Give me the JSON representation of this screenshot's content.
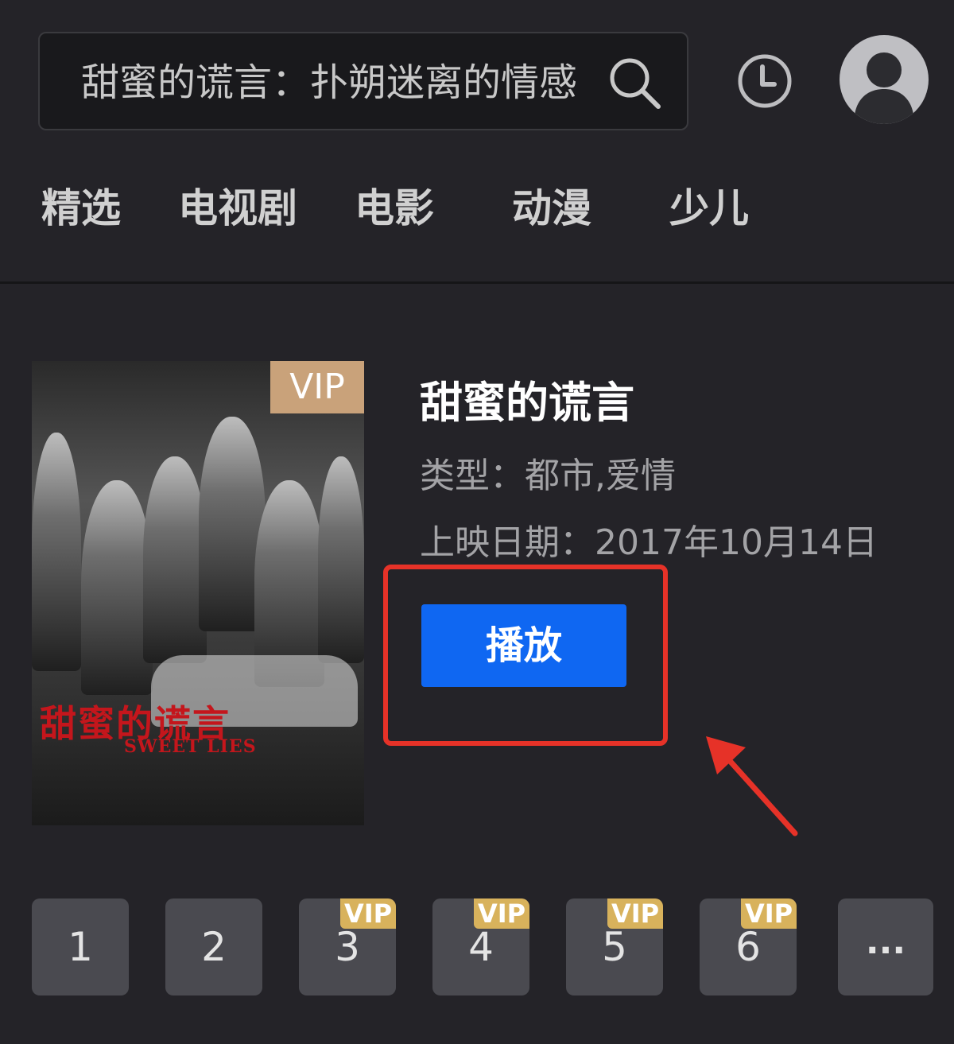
{
  "search": {
    "query": "甜蜜的谎言：扑朔迷离的情感"
  },
  "tabs": [
    {
      "label": "精选"
    },
    {
      "label": "电视剧"
    },
    {
      "label": "电影"
    },
    {
      "label": "动漫"
    },
    {
      "label": "少儿"
    }
  ],
  "poster": {
    "vip_badge": "VIP",
    "title_cn": "甜蜜的谎言",
    "title_en": "SWEET LIES"
  },
  "detail": {
    "title": "甜蜜的谎言",
    "genre": "类型：都市,爱情",
    "release_date": "上映日期：2017年10月14日",
    "play_label": "播放"
  },
  "episodes": [
    {
      "label": "1",
      "vip": ""
    },
    {
      "label": "2",
      "vip": ""
    },
    {
      "label": "3",
      "vip": "VIP"
    },
    {
      "label": "4",
      "vip": "VIP"
    },
    {
      "label": "5",
      "vip": "VIP"
    },
    {
      "label": "6",
      "vip": "VIP"
    }
  ],
  "more_label": "...",
  "colors": {
    "background": "#242328",
    "play_button": "#0f67f2",
    "highlight": "#e63228",
    "vip_gold": "#d8b25c"
  }
}
